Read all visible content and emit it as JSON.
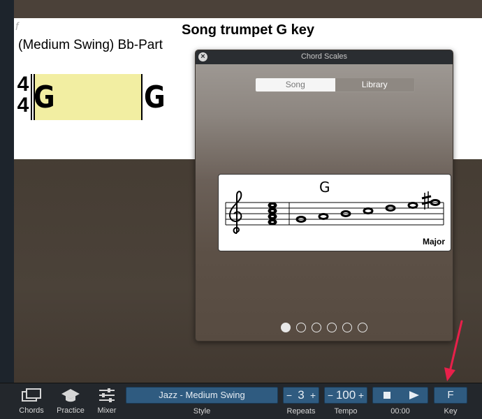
{
  "sheet": {
    "f_marker": "f",
    "title": "Song trumpet G key",
    "subtitle": "(Medium Swing) Bb-Part",
    "time_sig_top": "4",
    "time_sig_bottom": "4",
    "measures": [
      "G",
      "G"
    ]
  },
  "panel": {
    "title": "Chord Scales",
    "close_glyph": "×",
    "tabs": [
      {
        "label": "Song",
        "selected": false
      },
      {
        "label": "Library",
        "selected": true
      }
    ],
    "scale_chord": "G",
    "scale_name": "Major",
    "page_count": 6,
    "active_page": 1
  },
  "toolbar": {
    "chords_label": "Chords",
    "practice_label": "Practice",
    "mixer_label": "Mixer",
    "style_value": "Jazz - Medium Swing",
    "style_label": "Style",
    "repeats_minus": "−",
    "repeats_value": "3",
    "repeats_plus": "+",
    "repeats_label": "Repeats",
    "tempo_minus": "−",
    "tempo_value": "100",
    "tempo_plus": "+",
    "tempo_label": "Tempo",
    "time_value": "00:00",
    "key_value": "F",
    "key_label": "Key"
  },
  "colors": {
    "highlight": "#f2eea2",
    "toolbar_button": "#2f5b80",
    "annotation_arrow": "#e8204a"
  },
  "icons": {
    "close": "close-icon",
    "chords": "chords-icon",
    "practice": "graduation-cap-icon",
    "mixer": "sliders-icon",
    "stop": "stop-icon",
    "play": "play-icon",
    "arrow": "annotation-arrow-icon"
  }
}
